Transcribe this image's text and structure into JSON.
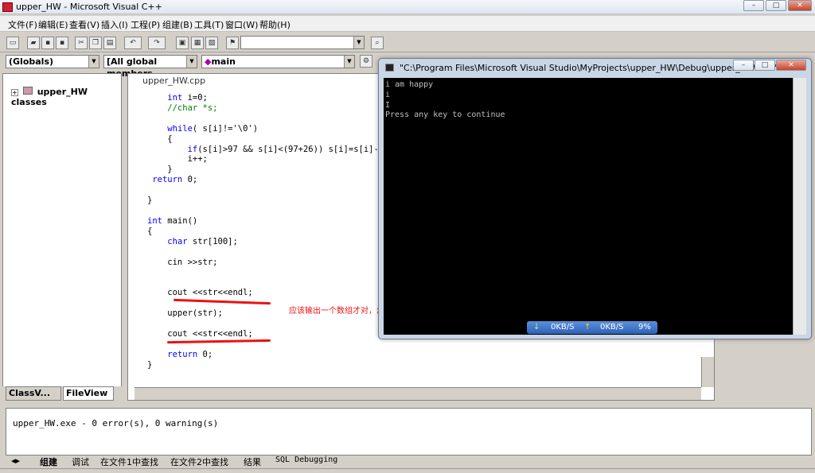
{
  "window": {
    "title": "upper_HW - Microsoft Visual C++",
    "min": "–",
    "max": "□",
    "close": "✕"
  },
  "menu": [
    "文件(F)",
    "编辑(E)",
    "查看(V)",
    "插入(I)",
    "工程(P)",
    "组建(B)",
    "工具(T)",
    "窗口(W)",
    "帮助(H)"
  ],
  "combos": {
    "globals": "(Globals)",
    "members": "[All global members",
    "function": "main"
  },
  "class_view": {
    "root": "upper_HW classes",
    "tab_class": "ClassV...",
    "tab_file": "FileView"
  },
  "editor": {
    "tab": "upper_HW.cpp",
    "lines": [
      {
        "t": "    int i=0;",
        "k": "int"
      },
      {
        "t": "    //char *s;",
        "c": true
      },
      {
        "t": ""
      },
      {
        "t": "    while( s[i]!='\\0')",
        "k": "while"
      },
      {
        "t": "    {"
      },
      {
        "t": "        if(s[i]>97 && s[i]<(97+26)) s[i]=s[i]-",
        "k": "if"
      },
      {
        "t": "        i++;"
      },
      {
        "t": "    }"
      },
      {
        "t": " return 0;",
        "k": "return"
      },
      {
        "t": ""
      },
      {
        "t": "}"
      },
      {
        "t": ""
      },
      {
        "t": "int main()",
        "k": "int"
      },
      {
        "t": "{"
      },
      {
        "t": "    char str[100];",
        "k": "char"
      },
      {
        "t": ""
      },
      {
        "t": "    cin >>str;"
      },
      {
        "t": ""
      },
      {
        "t": ""
      },
      {
        "t": "    cout <<str<<endl;"
      },
      {
        "t": ""
      },
      {
        "t": "    upper(str);"
      },
      {
        "t": ""
      },
      {
        "t": "    cout <<str<<endl;"
      },
      {
        "t": ""
      },
      {
        "t": "    return 0;",
        "k": "return"
      },
      {
        "t": "}"
      }
    ]
  },
  "annotation": "应该输出一个数组才对，怎么会只有一个字符呢？",
  "console": {
    "title": "\"C:\\Program Files\\Microsoft Visual Studio\\MyProjects\\upper_HW\\Debug\\upper_HW.exe\"",
    "output": "i am happy\ni\nI\nPress any key to continue",
    "net_down": "0KB/S",
    "net_up": "0KB/S",
    "net_pct": "9%"
  },
  "output_pane": {
    "text": "upper_HW.exe - 0 error(s), 0 warning(s)",
    "tabs": [
      "组建",
      "调试",
      "在文件1中查找",
      "在文件2中查找",
      "结果",
      "SQL Debugging"
    ]
  }
}
